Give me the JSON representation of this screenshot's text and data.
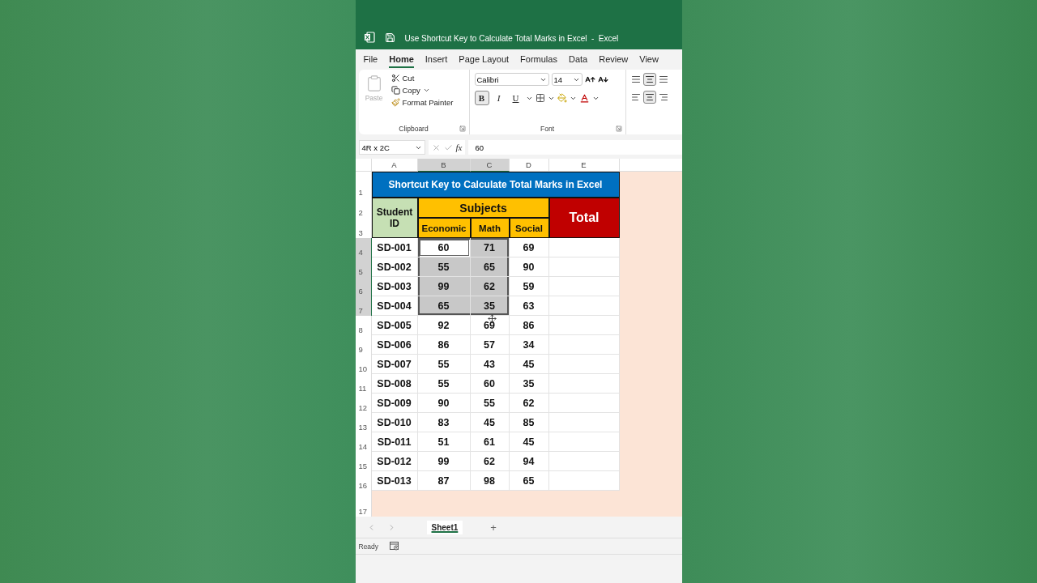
{
  "window": {
    "title": "Use Shortcut Key to Calculate Total Marks in Excel  -  Excel"
  },
  "menu_tabs": [
    {
      "label": "File",
      "selected": false
    },
    {
      "label": "Home",
      "selected": true
    },
    {
      "label": "Insert",
      "selected": false
    },
    {
      "label": "Page Layout",
      "selected": false
    },
    {
      "label": "Formulas",
      "selected": false
    },
    {
      "label": "Data",
      "selected": false
    },
    {
      "label": "Review",
      "selected": false
    },
    {
      "label": "View",
      "selected": false
    }
  ],
  "ribbon": {
    "clipboard": {
      "paste": {
        "label": "Paste",
        "disabled": true
      },
      "cut": "Cut",
      "copy": "Copy",
      "format_painter": "Format Painter",
      "label": "Clipboard"
    },
    "font": {
      "name": "Calibri",
      "size": "14",
      "bold_label": "B",
      "bold": true,
      "italic_label": "I",
      "underline_label": "U",
      "label": "Font"
    }
  },
  "formula_bar": {
    "name_box": "4R x 2C",
    "fx": "fx",
    "value": "60"
  },
  "sheet": {
    "columns": [
      {
        "label": "A",
        "selected": false
      },
      {
        "label": "B",
        "selected": true
      },
      {
        "label": "C",
        "selected": true
      },
      {
        "label": "D",
        "selected": false
      },
      {
        "label": "E",
        "selected": false
      }
    ],
    "row_numbers": [
      {
        "label": "1",
        "selected": false
      },
      {
        "label": "2",
        "selected": false
      },
      {
        "label": "3",
        "selected": false
      },
      {
        "label": "4",
        "selected": true
      },
      {
        "label": "5",
        "selected": true
      },
      {
        "label": "6",
        "selected": true
      },
      {
        "label": "7",
        "selected": true
      },
      {
        "label": "8",
        "selected": false
      },
      {
        "label": "9",
        "selected": false
      },
      {
        "label": "10",
        "selected": false
      },
      {
        "label": "11",
        "selected": false
      },
      {
        "label": "12",
        "selected": false
      },
      {
        "label": "13",
        "selected": false
      },
      {
        "label": "14",
        "selected": false
      },
      {
        "label": "15",
        "selected": false
      },
      {
        "label": "16",
        "selected": false
      },
      {
        "label": "17",
        "selected": false
      }
    ],
    "title": "Shortcut Key to Calculate Total Marks in Excel",
    "header": {
      "student_id": "Student ID",
      "subjects": "Subjects",
      "total": "Total",
      "subject_columns": [
        "Economic",
        "Math",
        "Social"
      ]
    },
    "records": [
      {
        "id": "SD-001",
        "scores": [
          {
            "value": "60",
            "selected": true,
            "active": true
          },
          {
            "value": "71",
            "selected": true,
            "active": false
          },
          {
            "value": "69",
            "selected": false,
            "active": false
          }
        ]
      },
      {
        "id": "SD-002",
        "scores": [
          {
            "value": "55",
            "selected": true,
            "active": false
          },
          {
            "value": "65",
            "selected": true,
            "active": false
          },
          {
            "value": "90",
            "selected": false,
            "active": false
          }
        ]
      },
      {
        "id": "SD-003",
        "scores": [
          {
            "value": "99",
            "selected": true,
            "active": false
          },
          {
            "value": "62",
            "selected": true,
            "active": false
          },
          {
            "value": "59",
            "selected": false,
            "active": false
          }
        ]
      },
      {
        "id": "SD-004",
        "scores": [
          {
            "value": "65",
            "selected": true,
            "active": false
          },
          {
            "value": "35",
            "selected": true,
            "active": false
          },
          {
            "value": "63",
            "selected": false,
            "active": false
          }
        ]
      },
      {
        "id": "SD-005",
        "scores": [
          {
            "value": "92",
            "selected": false,
            "active": false
          },
          {
            "value": "69",
            "selected": false,
            "active": false
          },
          {
            "value": "86",
            "selected": false,
            "active": false
          }
        ]
      },
      {
        "id": "SD-006",
        "scores": [
          {
            "value": "86",
            "selected": false,
            "active": false
          },
          {
            "value": "57",
            "selected": false,
            "active": false
          },
          {
            "value": "34",
            "selected": false,
            "active": false
          }
        ]
      },
      {
        "id": "SD-007",
        "scores": [
          {
            "value": "55",
            "selected": false,
            "active": false
          },
          {
            "value": "43",
            "selected": false,
            "active": false
          },
          {
            "value": "45",
            "selected": false,
            "active": false
          }
        ]
      },
      {
        "id": "SD-008",
        "scores": [
          {
            "value": "55",
            "selected": false,
            "active": false
          },
          {
            "value": "60",
            "selected": false,
            "active": false
          },
          {
            "value": "35",
            "selected": false,
            "active": false
          }
        ]
      },
      {
        "id": "SD-009",
        "scores": [
          {
            "value": "90",
            "selected": false,
            "active": false
          },
          {
            "value": "55",
            "selected": false,
            "active": false
          },
          {
            "value": "62",
            "selected": false,
            "active": false
          }
        ]
      },
      {
        "id": "SD-010",
        "scores": [
          {
            "value": "83",
            "selected": false,
            "active": false
          },
          {
            "value": "45",
            "selected": false,
            "active": false
          },
          {
            "value": "85",
            "selected": false,
            "active": false
          }
        ]
      },
      {
        "id": "SD-011",
        "scores": [
          {
            "value": "51",
            "selected": false,
            "active": false
          },
          {
            "value": "61",
            "selected": false,
            "active": false
          },
          {
            "value": "45",
            "selected": false,
            "active": false
          }
        ]
      },
      {
        "id": "SD-012",
        "scores": [
          {
            "value": "99",
            "selected": false,
            "active": false
          },
          {
            "value": "62",
            "selected": false,
            "active": false
          },
          {
            "value": "94",
            "selected": false,
            "active": false
          }
        ]
      },
      {
        "id": "SD-013",
        "scores": [
          {
            "value": "87",
            "selected": false,
            "active": false
          },
          {
            "value": "98",
            "selected": false,
            "active": false
          },
          {
            "value": "65",
            "selected": false,
            "active": false
          }
        ]
      }
    ]
  },
  "sheet_tabs": [
    {
      "label": "Sheet1",
      "selected": true
    }
  ],
  "add_sheet": "+",
  "status_bar": {
    "text": "Ready"
  }
}
